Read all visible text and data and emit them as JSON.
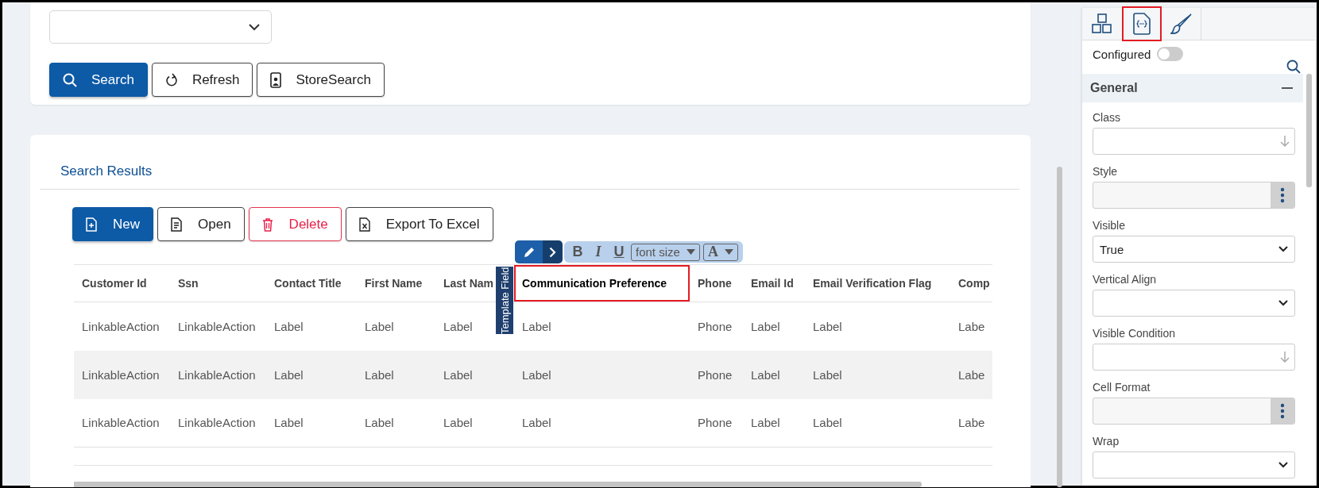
{
  "search_buttons": [
    {
      "label": "Search",
      "kind": "primary"
    },
    {
      "label": "Refresh",
      "kind": "outline"
    },
    {
      "label": "StoreSearch",
      "kind": "outline"
    }
  ],
  "results": {
    "title": "Search Results",
    "buttons": [
      {
        "label": "New",
        "kind": "primary"
      },
      {
        "label": "Open",
        "kind": "outline"
      },
      {
        "label": "Delete",
        "kind": "danger"
      },
      {
        "label": "Export To Excel",
        "kind": "outline"
      }
    ],
    "editor_toolbar": {
      "format_buttons": [
        "B",
        "I",
        "U"
      ],
      "font_size": "font size",
      "font_color": "A"
    },
    "template_label": "Template Field",
    "table": {
      "columns": [
        {
          "label": "Customer Id",
          "selected": false
        },
        {
          "label": "Ssn",
          "selected": false
        },
        {
          "label": "Contact Title",
          "selected": false
        },
        {
          "label": "First Name",
          "selected": false
        },
        {
          "label": "Last Nam",
          "selected": false
        },
        {
          "label": "Communication Preference",
          "selected": true
        },
        {
          "label": "Phone",
          "selected": false
        },
        {
          "label": "Email Id",
          "selected": false
        },
        {
          "label": "Email Verification Flag",
          "selected": false
        },
        {
          "label": "Comp",
          "selected": false
        }
      ],
      "rows": [
        {
          "cells": [
            "LinkableAction",
            "LinkableAction",
            "Label",
            "Label",
            "Label",
            "Label",
            "Phone",
            "Label",
            "Label",
            "Labe"
          ]
        },
        {
          "cells": [
            "LinkableAction",
            "LinkableAction",
            "Label",
            "Label",
            "Label",
            "Label",
            "Phone",
            "Label",
            "Label",
            "Labe"
          ]
        },
        {
          "cells": [
            "LinkableAction",
            "LinkableAction",
            "Label",
            "Label",
            "Label",
            "Label",
            "Phone",
            "Label",
            "Label",
            "Labe"
          ]
        }
      ]
    }
  },
  "properties_panel": {
    "tabs": [
      {
        "selected": false
      },
      {
        "selected": true
      },
      {
        "selected": false
      }
    ],
    "configured": {
      "label": "Configured",
      "on": false
    },
    "section": {
      "title": "General",
      "expanded": true
    },
    "fields": [
      {
        "label": "Class",
        "kind": "lookup"
      },
      {
        "label": "Style",
        "kind": "menu"
      },
      {
        "label": "Visible",
        "kind": "select",
        "value": "True"
      },
      {
        "label": "Vertical Align",
        "kind": "select"
      },
      {
        "label": "Visible Condition",
        "kind": "lookup"
      },
      {
        "label": "Cell Format",
        "kind": "menu"
      },
      {
        "label": "Wrap",
        "kind": "select"
      }
    ]
  }
}
